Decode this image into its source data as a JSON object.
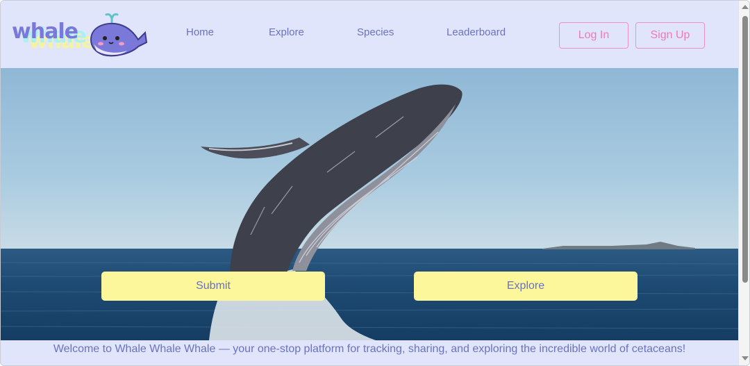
{
  "brand": {
    "logo_text": "whale",
    "logo_icon": "whale-mascot-icon"
  },
  "nav": {
    "items": [
      {
        "label": "Home"
      },
      {
        "label": "Explore"
      },
      {
        "label": "Species"
      },
      {
        "label": "Leaderboard"
      }
    ]
  },
  "auth": {
    "login_label": "Log In",
    "signup_label": "Sign Up"
  },
  "hero": {
    "image": "humpback-whale-breaching-photo",
    "submit_label": "Submit",
    "explore_label": "Explore"
  },
  "footer": {
    "welcome_text": "Welcome to Whale Whale Whale — your one-stop platform for tracking, sharing, and exploring the incredible world of cetaceans!"
  },
  "colors": {
    "header_bg": "#e0e5fc",
    "nav_text": "#6a72c0",
    "accent_pink": "#f079b8",
    "cta_yellow": "#fbf79a"
  }
}
